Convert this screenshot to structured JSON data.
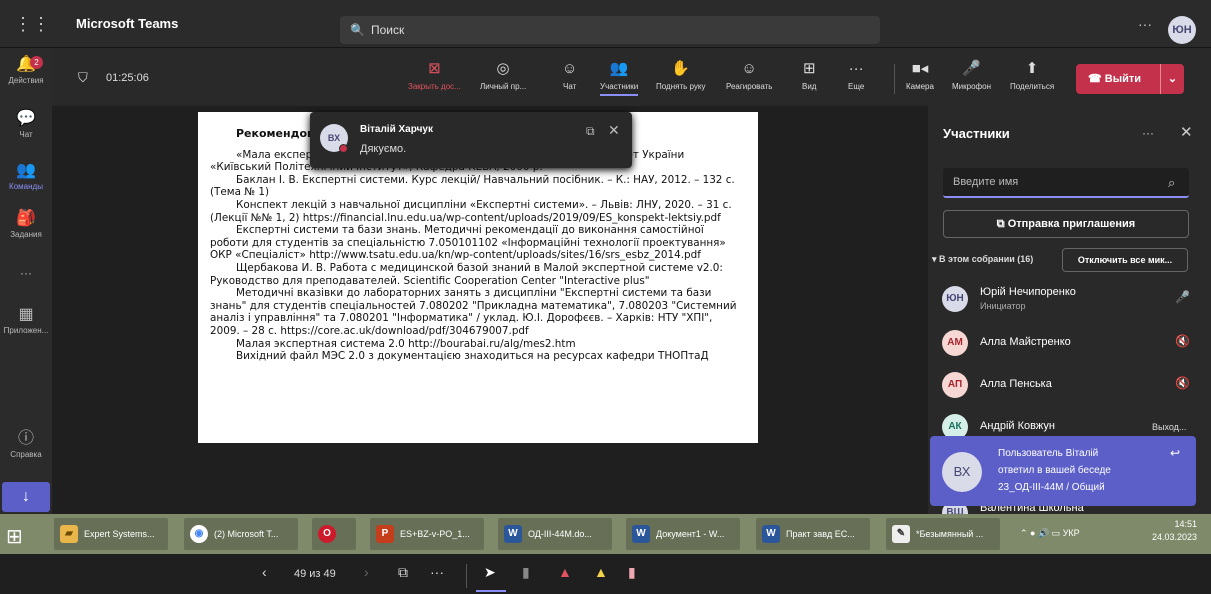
{
  "header": {
    "app_name": "Microsoft Teams",
    "search_placeholder": "Поиск",
    "more": "···",
    "user_initials": "ЮН"
  },
  "rail": {
    "items": [
      {
        "label": "Действия",
        "icon": "bell-icon",
        "badge": "2"
      },
      {
        "label": "Чат",
        "icon": "chat-icon"
      },
      {
        "label": "Команды",
        "icon": "teams-icon"
      },
      {
        "label": "Задания",
        "icon": "assignments-icon"
      },
      {
        "label": "···",
        "icon": "more-icon"
      },
      {
        "label": "Приложен...",
        "icon": "apps-icon"
      },
      {
        "label": "Справка",
        "icon": "help-icon"
      }
    ]
  },
  "meeting": {
    "timer": "01:25:06",
    "controls": [
      {
        "label": "Закрыть дос...",
        "icon": "close-share-icon"
      },
      {
        "label": "Личный пр...",
        "icon": "eye-icon"
      },
      {
        "label": "Чат",
        "icon": "chat-icon"
      },
      {
        "label": "Участники",
        "icon": "people-icon"
      },
      {
        "label": "Поднять руку",
        "icon": "hand-icon"
      },
      {
        "label": "Реагировать",
        "icon": "smile-icon"
      },
      {
        "label": "Вид",
        "icon": "grid-icon"
      },
      {
        "label": "Еще",
        "icon": "more-icon"
      },
      {
        "label": "Камера",
        "icon": "camera-icon"
      },
      {
        "label": "Микрофон",
        "icon": "mic-icon"
      },
      {
        "label": "Поделиться",
        "icon": "share-icon"
      }
    ],
    "leave_label": "Выйти"
  },
  "document": {
    "heading": "Рекомендована л",
    "paragraphs": [
      "«Мала експертна с                                                      во користувача. Національний технічний університет України «Київський Політехнічний Інститут», Кафедра КЕВА, 2000 р.",
      "Баклан І. В. Експертні системи. Курс лекцій/ Навчальний посібник. – К.: НАУ, 2012. – 132 с. (Тема № 1)",
      "Конспект лекцій з навчальної дисципліни «Експертні системи». – Львів: ЛНУ, 2020. – 31 с. (Лекції №№ 1, 2) https://financial.lnu.edu.ua/wp-content/uploads/2019/09/ES_konspekt-lektsiy.pdf",
      "Експертні системи та бази знань. Методичні рекомендації до виконання самостійної роботи для студентів за спеціальністю 7.050101102 «Інформаційні технології проектування» ОКР «Спеціаліст» http://www.tsatu.edu.ua/kn/wp-content/uploads/sites/16/srs_esbz_2014.pdf",
      "Щербакова И. В. Работа с медицинской базой знаний в Малой экспертной системе v2.0: Руководство для преподавателей. Scientific Cooperation Center \"Interactive plus\"",
      "Методичні вказівки до лабораторних занять з дисципліни \"Експертні системи та бази знань\" для студентів спеціальностей 7.080202 \"Прикладна математика\", 7.080203 \"Системний аналіз і управління\" та 7.080201 \"Інформатика\" / уклад. Ю.І. Дорофєєв. – Харків: НТУ \"ХПІ\", 2009. – 28 с. https://core.ac.uk/download/pdf/304679007.pdf",
      "Малая экспертная система 2.0 http://bourabai.ru/alg/mes2.htm",
      "Вихідний файл МЭС 2.0 з документацією знаходиться на ресурсах кафедри ТНОПтаД"
    ]
  },
  "chat_toast": {
    "initials": "ВХ",
    "name": "Віталій Харчук",
    "message": "Дякуємо."
  },
  "presentation": {
    "page_counter": "49 из 49"
  },
  "participants": {
    "title": "Участники",
    "search_placeholder": "Введите имя",
    "invite_label": "Отправка приглашения",
    "section_label": "В этом собрании (16)",
    "mute_all_label": "Отключить все мик...",
    "people": [
      {
        "initials": "ЮН",
        "name": "Юрій Нечипоренко",
        "role": "Инициатор",
        "avatar_bg": "#d9dbe8",
        "avatar_fg": "#464775"
      },
      {
        "initials": "АМ",
        "name": "Алла Майстренко",
        "avatar_bg": "#f7d7d4",
        "avatar_fg": "#a4262c"
      },
      {
        "initials": "АП",
        "name": "Алла Пенська",
        "avatar_bg": "#f7d7d4",
        "avatar_fg": "#a4262c"
      },
      {
        "initials": "АК",
        "name": "Андрій Ковжун",
        "status": "Выход...",
        "avatar_bg": "#d5efe8",
        "avatar_fg": "#1b7160"
      },
      {
        "initials": "ВШ",
        "name": "Валентина Школьна",
        "avatar_bg": "#d9dbe8",
        "avatar_fg": "#464775"
      }
    ]
  },
  "notification": {
    "initials": "ВХ",
    "line1": "Пользователь Віталій",
    "line2": "ответил в вашей беседе",
    "line3": "23_ОД-ІІІ-44М / Общий"
  },
  "taskbar": {
    "items": [
      {
        "label": "Expert Systems...",
        "icon": "folder-icon"
      },
      {
        "label": "(2) Microsoft T...",
        "icon": "chrome-icon"
      },
      {
        "label": "",
        "icon": "opera-icon"
      },
      {
        "label": "ES+BZ-v-PO_1...",
        "icon": "powerpoint-icon"
      },
      {
        "label": "ОД-ІІІ-44М.do...",
        "icon": "word-icon"
      },
      {
        "label": "Документ1 - W...",
        "icon": "word-icon"
      },
      {
        "label": "Практ завд ЕС...",
        "icon": "word-icon"
      },
      {
        "label": "*Безымянный ...",
        "icon": "paint-icon"
      }
    ],
    "lang": "УКР",
    "time": "14:51",
    "date": "24.03.2023"
  },
  "colors": {
    "accent": "#5b5fc7",
    "leave": "#c4314b",
    "background": "#1f1f1f"
  }
}
